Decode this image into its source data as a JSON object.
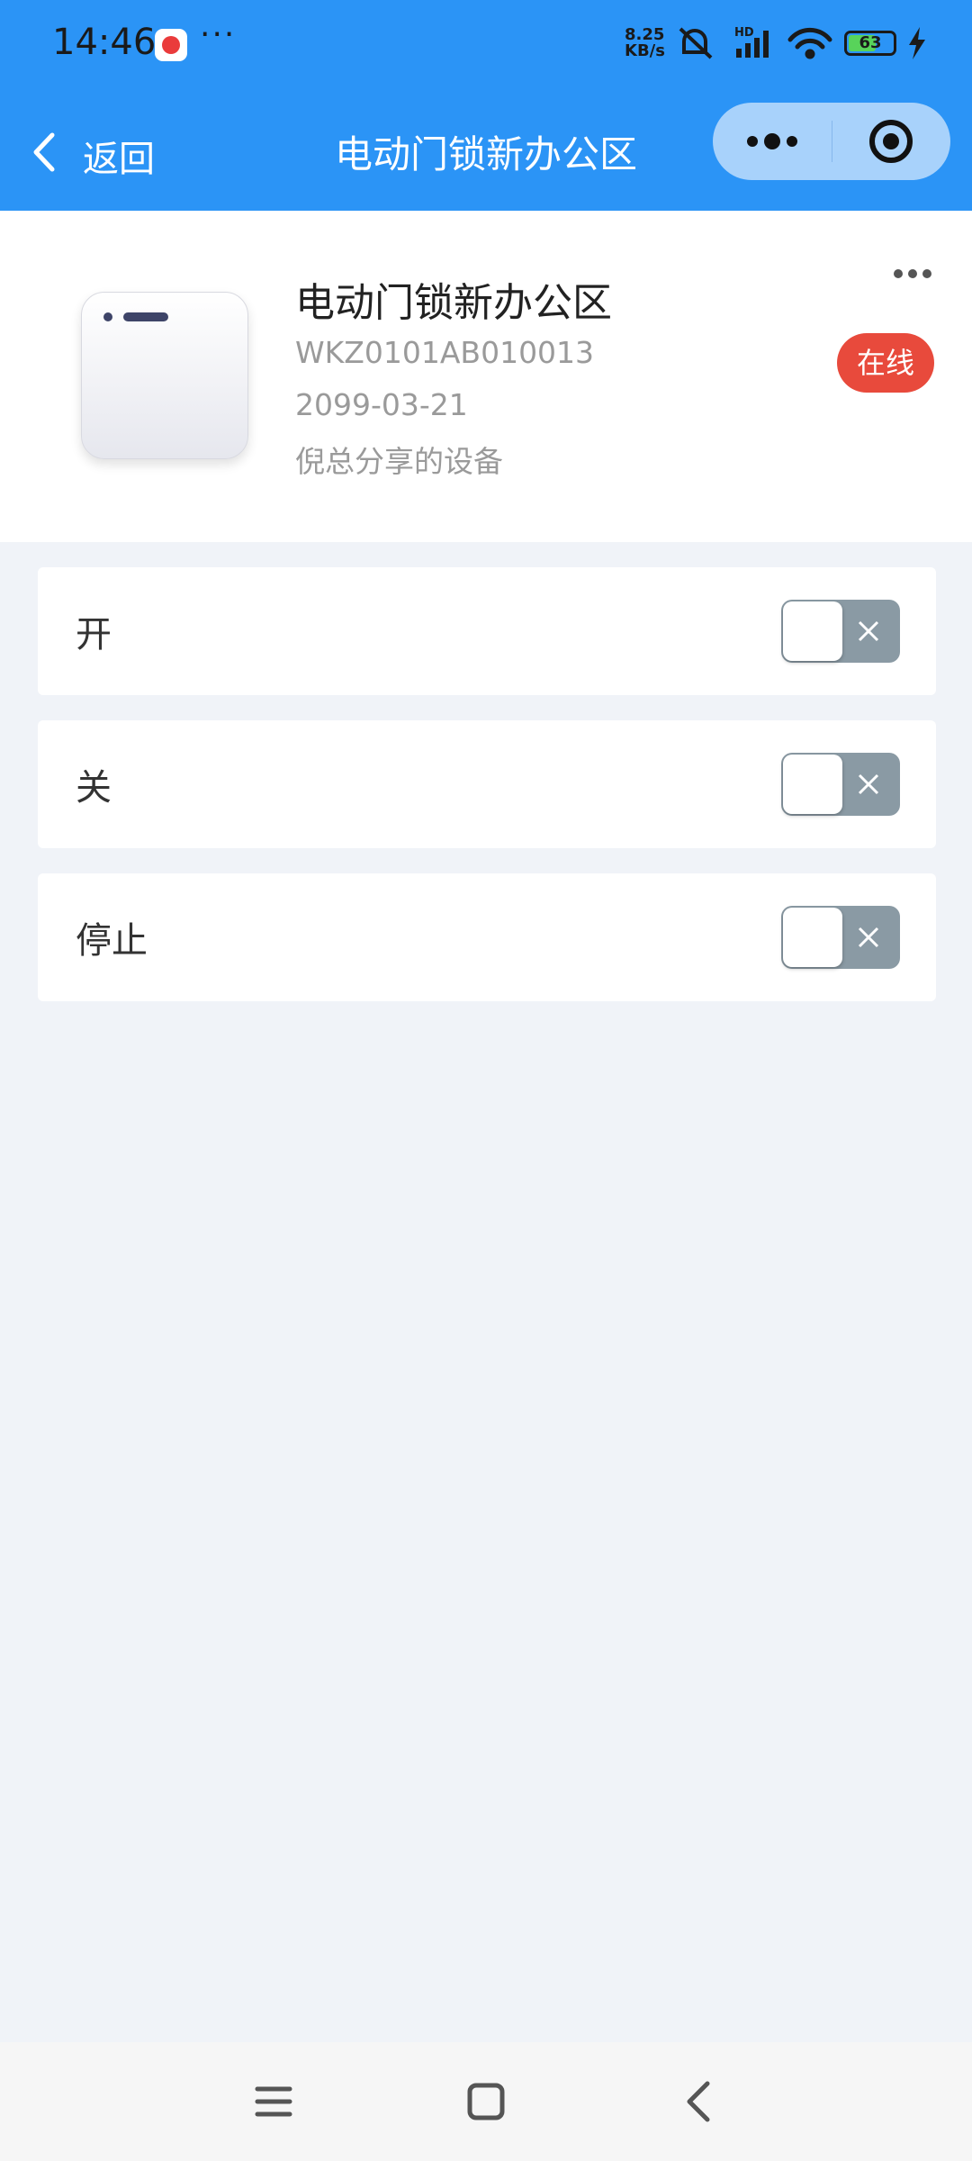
{
  "status_bar": {
    "time": "14:46",
    "dots": "···",
    "net_speed_value": "8.25",
    "net_speed_unit": "KB/s",
    "signal_label": "HD",
    "battery_level": 63,
    "battery_text": "63",
    "icons": [
      "video-app-icon",
      "mute-bell-icon",
      "signal-icon",
      "wifi-icon",
      "battery-icon",
      "charging-bolt-icon"
    ]
  },
  "nav": {
    "back_label": "返回",
    "title": "电动门锁新办公区",
    "accent_color": "#2b94f6"
  },
  "device": {
    "name": "电动门锁新办公区",
    "serial": "WKZ0101AB010013",
    "date": "2099-03-21",
    "share_note": "倪总分享的设备",
    "status": "在线",
    "status_color": "#e84a3c"
  },
  "controls": [
    {
      "label": "开",
      "on": false
    },
    {
      "label": "关",
      "on": false
    },
    {
      "label": "停止",
      "on": false
    }
  ]
}
